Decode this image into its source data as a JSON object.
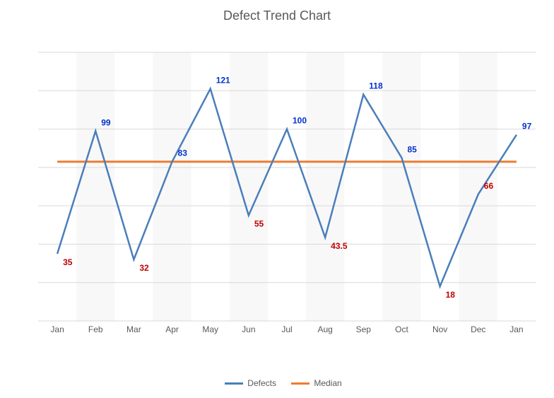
{
  "chart_data": {
    "type": "line",
    "title": "Defect Trend Chart",
    "categories": [
      "Jan",
      "Feb",
      "Mar",
      "Apr",
      "May",
      "Jun",
      "Jul",
      "Aug",
      "Sep",
      "Oct",
      "Nov",
      "Dec",
      "Jan"
    ],
    "y_ticks": [
      0,
      20,
      40,
      60,
      80,
      100,
      120,
      140
    ],
    "ylim": [
      0,
      140
    ],
    "series": [
      {
        "name": "Defects",
        "color": "#4a7ebb",
        "values": [
          35,
          99,
          32,
          83,
          121,
          55,
          100,
          43.5,
          118,
          85,
          18,
          66,
          97
        ]
      },
      {
        "name": "Median",
        "color": "#ed7d31",
        "values": [
          83,
          83,
          83,
          83,
          83,
          83,
          83,
          83,
          83,
          83,
          83,
          83,
          83
        ]
      }
    ],
    "data_labels": [
      {
        "i": 0,
        "v": 35,
        "text": "35",
        "pos": "below",
        "color": "red"
      },
      {
        "i": 1,
        "v": 99,
        "text": "99",
        "pos": "above",
        "color": "blue"
      },
      {
        "i": 2,
        "v": 32,
        "text": "32",
        "pos": "below",
        "color": "red"
      },
      {
        "i": 3,
        "v": 83,
        "text": "83",
        "pos": "above",
        "color": "blue"
      },
      {
        "i": 4,
        "v": 121,
        "text": "121",
        "pos": "above",
        "color": "blue"
      },
      {
        "i": 5,
        "v": 55,
        "text": "55",
        "pos": "below",
        "color": "red"
      },
      {
        "i": 6,
        "v": 100,
        "text": "100",
        "pos": "above",
        "color": "blue"
      },
      {
        "i": 7,
        "v": 43.5,
        "text": "43.5",
        "pos": "below",
        "color": "red"
      },
      {
        "i": 8,
        "v": 118,
        "text": "118",
        "pos": "above",
        "color": "blue"
      },
      {
        "i": 9,
        "v": 85,
        "text": "85",
        "pos": "above",
        "color": "blue"
      },
      {
        "i": 10,
        "v": 18,
        "text": "18",
        "pos": "below",
        "color": "red"
      },
      {
        "i": 11,
        "v": 66,
        "text": "66",
        "pos": "above",
        "color": "red"
      },
      {
        "i": 12,
        "v": 97,
        "text": "97",
        "pos": "above",
        "color": "blue"
      }
    ],
    "legend": {
      "defects": "Defects",
      "median": "Median"
    }
  }
}
